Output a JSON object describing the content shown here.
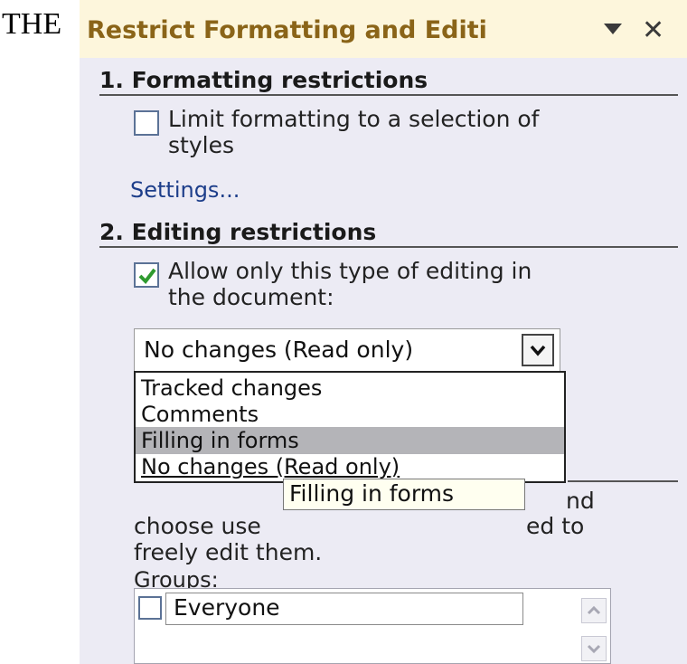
{
  "document": {
    "visible_word": "THE"
  },
  "pane": {
    "title": "Restrict Formatting and Editi",
    "menu_icon": "triangle-down-icon",
    "close_icon": "close-icon"
  },
  "formatting": {
    "heading": "1. Formatting restrictions",
    "checkbox_label_line1": "Limit formatting to a selection of",
    "checkbox_label_line2": "styles",
    "checked": false,
    "settings_link": "Settings..."
  },
  "editing": {
    "heading": "2. Editing restrictions",
    "checkbox_label_line1": "Allow only this type of editing in",
    "checkbox_label_line2": "the document:",
    "checked": true,
    "selected_value": "No changes (Read only)",
    "options": [
      "Tracked changes",
      "Comments",
      "Filling in forms",
      "No changes (Read only)"
    ],
    "highlighted_option": "Filling in forms",
    "tooltip": "Filling in forms"
  },
  "exceptions": {
    "partial_line1_start": "",
    "partial_line1_end": "nd",
    "partial_line2_start": "choose use",
    "partial_line2_end": "ed to",
    "line3": "freely edit them.",
    "groups_label": "Groups:",
    "groups": [
      {
        "name": "Everyone",
        "checked": false
      }
    ]
  }
}
